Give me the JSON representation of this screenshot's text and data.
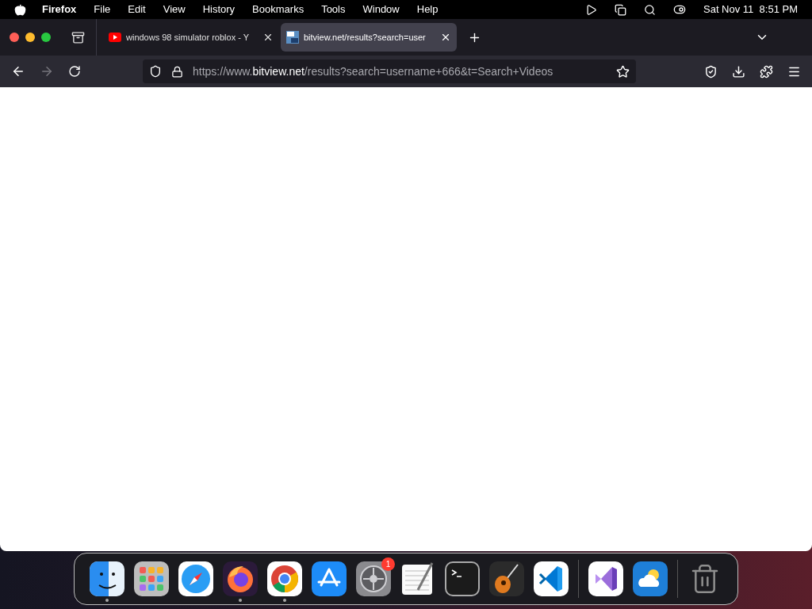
{
  "menu_bar": {
    "app": "Firefox",
    "items": [
      "File",
      "Edit",
      "View",
      "History",
      "Bookmarks",
      "Tools",
      "Window",
      "Help"
    ],
    "clock": "Sat Nov 11  8:51 PM"
  },
  "tabs": [
    {
      "title": "windows 98 simulator roblox - Y",
      "kind": "video",
      "selected": false
    },
    {
      "title": "bitview.net/results?search=user",
      "kind": "site",
      "selected": true
    }
  ],
  "address_bar": {
    "prefix": "https://www.",
    "host": "bitview.net",
    "path": "/results?search=username+666&t=Search+Videos"
  },
  "dock": {
    "apps": [
      {
        "kind": "finder",
        "running": true
      },
      {
        "kind": "launchpad",
        "running": false
      },
      {
        "kind": "safari",
        "running": false
      },
      {
        "kind": "firefox",
        "running": true
      },
      {
        "kind": "chrome",
        "running": true
      },
      {
        "kind": "appstore",
        "running": false
      },
      {
        "kind": "settings",
        "running": false,
        "badge": "1"
      },
      {
        "kind": "textedit",
        "running": false
      },
      {
        "kind": "terminal",
        "running": false
      },
      {
        "kind": "garageband",
        "running": false
      },
      {
        "kind": "vscode",
        "running": false
      },
      {
        "kind": "divider"
      },
      {
        "kind": "visualstudio",
        "running": false
      },
      {
        "kind": "weather",
        "running": false
      },
      {
        "kind": "divider"
      },
      {
        "kind": "trash",
        "running": false
      }
    ]
  }
}
